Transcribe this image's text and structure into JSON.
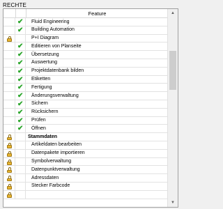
{
  "section_title": "RECHTE",
  "columns": {
    "feature": "Feature"
  },
  "scroll_up_glyph": "▲",
  "scroll_down_glyph": "▼",
  "rows": [
    {
      "name": "Fluid Engineering",
      "locked": false,
      "checked": true,
      "bold": false
    },
    {
      "name": "Building Automation",
      "locked": false,
      "checked": true,
      "bold": false
    },
    {
      "name": "P+I Diagram",
      "locked": true,
      "checked": false,
      "bold": false
    },
    {
      "name": "Editieren von Planseite",
      "locked": false,
      "checked": true,
      "bold": false
    },
    {
      "name": "Übersetzung",
      "locked": false,
      "checked": true,
      "bold": false
    },
    {
      "name": "Auswertung",
      "locked": false,
      "checked": true,
      "bold": false
    },
    {
      "name": "Projektdatenbank bilden",
      "locked": false,
      "checked": true,
      "bold": false
    },
    {
      "name": "Etiketten",
      "locked": false,
      "checked": true,
      "bold": false
    },
    {
      "name": "Fertigung",
      "locked": false,
      "checked": true,
      "bold": false
    },
    {
      "name": "Änderungsverwaltung",
      "locked": false,
      "checked": true,
      "bold": false
    },
    {
      "name": "Sichern",
      "locked": false,
      "checked": true,
      "bold": false
    },
    {
      "name": "Rücksichern",
      "locked": false,
      "checked": true,
      "bold": false
    },
    {
      "name": "Prüfen",
      "locked": false,
      "checked": true,
      "bold": false
    },
    {
      "name": "Öffnen",
      "locked": false,
      "checked": true,
      "bold": false
    },
    {
      "name": "Stammdaten",
      "locked": true,
      "checked": false,
      "bold": true
    },
    {
      "name": "Artikeldaten bearbeiten",
      "locked": true,
      "checked": false,
      "bold": false
    },
    {
      "name": "Datenpakete importieren",
      "locked": true,
      "checked": false,
      "bold": false
    },
    {
      "name": "Symbolverwaltung",
      "locked": true,
      "checked": false,
      "bold": false
    },
    {
      "name": "Datenpunktverwaltung",
      "locked": true,
      "checked": false,
      "bold": false
    },
    {
      "name": "Adressdaten",
      "locked": true,
      "checked": false,
      "bold": false
    },
    {
      "name": "Stecker Farbcode",
      "locked": true,
      "checked": false,
      "bold": false
    },
    {
      "name": "",
      "locked": true,
      "checked": false,
      "bold": false
    }
  ],
  "icons": {
    "check": "check-icon",
    "lock": "lock-icon"
  },
  "colors": {
    "check": "#2aa52a",
    "lock": "#e9b52e"
  }
}
